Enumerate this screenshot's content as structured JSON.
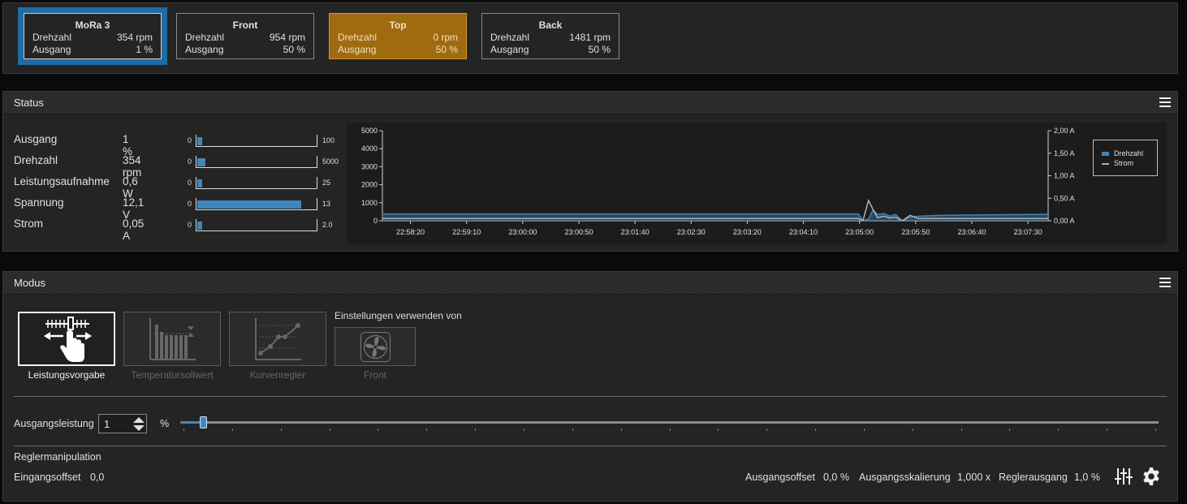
{
  "fans": [
    {
      "name": "MoRa 3",
      "rpm_label": "Drehzahl",
      "rpm": "354 rpm",
      "out_label": "Ausgang",
      "out": "1 %"
    },
    {
      "name": "Front",
      "rpm_label": "Drehzahl",
      "rpm": "954 rpm",
      "out_label": "Ausgang",
      "out": "50 %"
    },
    {
      "name": "Top",
      "rpm_label": "Drehzahl",
      "rpm": "0 rpm",
      "out_label": "Ausgang",
      "out": "50 %"
    },
    {
      "name": "Back",
      "rpm_label": "Drehzahl",
      "rpm": "1481 rpm",
      "out_label": "Ausgang",
      "out": "50 %"
    }
  ],
  "status": {
    "title": "Status",
    "rows": [
      {
        "label": "Ausgang",
        "value": "1 %",
        "min": "0",
        "max": "100",
        "fraction": 0.01
      },
      {
        "label": "Drehzahl",
        "value": "354 rpm",
        "min": "0",
        "max": "5000",
        "fraction": 0.0708
      },
      {
        "label": "Leistungsaufnahme",
        "value": "0,6 W",
        "min": "0",
        "max": "25",
        "fraction": 0.024
      },
      {
        "label": "Spannung",
        "value": "12,1 V",
        "min": "0",
        "max": "13",
        "fraction": 0.93
      },
      {
        "label": "Strom",
        "value": "0,05 A",
        "min": "0",
        "max": "2.0",
        "fraction": 0.025
      }
    ]
  },
  "chart_data": {
    "type": "line",
    "x": [
      "22:57:55",
      "22:58:20",
      "22:58:45",
      "22:59:10",
      "22:59:35",
      "23:00:00",
      "23:00:25",
      "23:00:50",
      "23:01:15",
      "23:01:40",
      "23:02:05",
      "23:02:30",
      "23:02:55",
      "23:03:20",
      "23:03:45",
      "23:04:10",
      "23:04:35",
      "23:04:59",
      "23:05:03",
      "23:05:08",
      "23:05:12",
      "23:05:16",
      "23:05:22",
      "23:05:27",
      "23:05:32",
      "23:05:38",
      "23:05:45",
      "23:05:52",
      "23:06:10",
      "23:06:40",
      "23:07:10",
      "23:07:40",
      "23:07:48"
    ],
    "x_tick_labels": [
      "22:58:20",
      "22:59:10",
      "23:00:00",
      "23:00:50",
      "23:01:40",
      "23:02:30",
      "23:03:20",
      "23:04:10",
      "23:05:00",
      "23:05:50",
      "23:06:40",
      "23:07:30"
    ],
    "y_left_ticks": [
      "5000",
      "4000",
      "3000",
      "2000",
      "1000",
      "0"
    ],
    "y_right_ticks": [
      "2,00 A",
      "1,50 A",
      "1,00 A",
      "0,50 A",
      "0,00 A"
    ],
    "ylim_left": [
      0,
      5000
    ],
    "ylim_right": [
      0,
      2.0
    ],
    "series": [
      {
        "name": "Drehzahl",
        "axis": "left",
        "color": "#3e87bd",
        "values": [
          380,
          380,
          380,
          380,
          380,
          380,
          380,
          380,
          380,
          380,
          380,
          380,
          380,
          380,
          380,
          380,
          380,
          380,
          0,
          100,
          600,
          350,
          400,
          250,
          350,
          0,
          200,
          250,
          300,
          320,
          340,
          354,
          354
        ]
      },
      {
        "name": "Strom",
        "axis": "right",
        "color": "#b0b0b0",
        "values": [
          0.05,
          0.05,
          0.05,
          0.05,
          0.05,
          0.05,
          0.05,
          0.05,
          0.05,
          0.05,
          0.05,
          0.05,
          0.05,
          0.05,
          0.05,
          0.05,
          0.05,
          0.05,
          0.0,
          0.45,
          0.25,
          0.07,
          0.1,
          0.06,
          0.08,
          0.0,
          0.12,
          0.05,
          0.05,
          0.05,
          0.05,
          0.05,
          0.05
        ]
      }
    ],
    "legend": "right"
  },
  "modus": {
    "title": "Modus",
    "modes": [
      {
        "label": "Leistungsvorgabe",
        "active": true
      },
      {
        "label": "Temperatursollwert",
        "active": false
      },
      {
        "label": "Kurvenregler",
        "active": false
      }
    ],
    "settings_from_label": "Einstellungen verwenden von",
    "settings_from_fan": "Front",
    "output_label": "Ausgangsleistung",
    "output_value": "1",
    "output_unit": "%",
    "output_fraction": 0.01,
    "regler_title": "Reglermanipulation",
    "input_offset_label": "Eingangsoffset",
    "input_offset_value": "0,0",
    "output_offset_label": "Ausgangsoffset",
    "output_offset_value": "0,0 %",
    "output_scaling_label": "Ausgangsskalierung",
    "output_scaling_value": "1,000 x",
    "regler_output_label": "Reglerausgang",
    "regler_output_value": "1,0 %"
  },
  "icons": {
    "menu": "hamburger-icon",
    "mixer": "sliders-icon",
    "settings": "gear-icon",
    "fan": "fan-icon"
  }
}
